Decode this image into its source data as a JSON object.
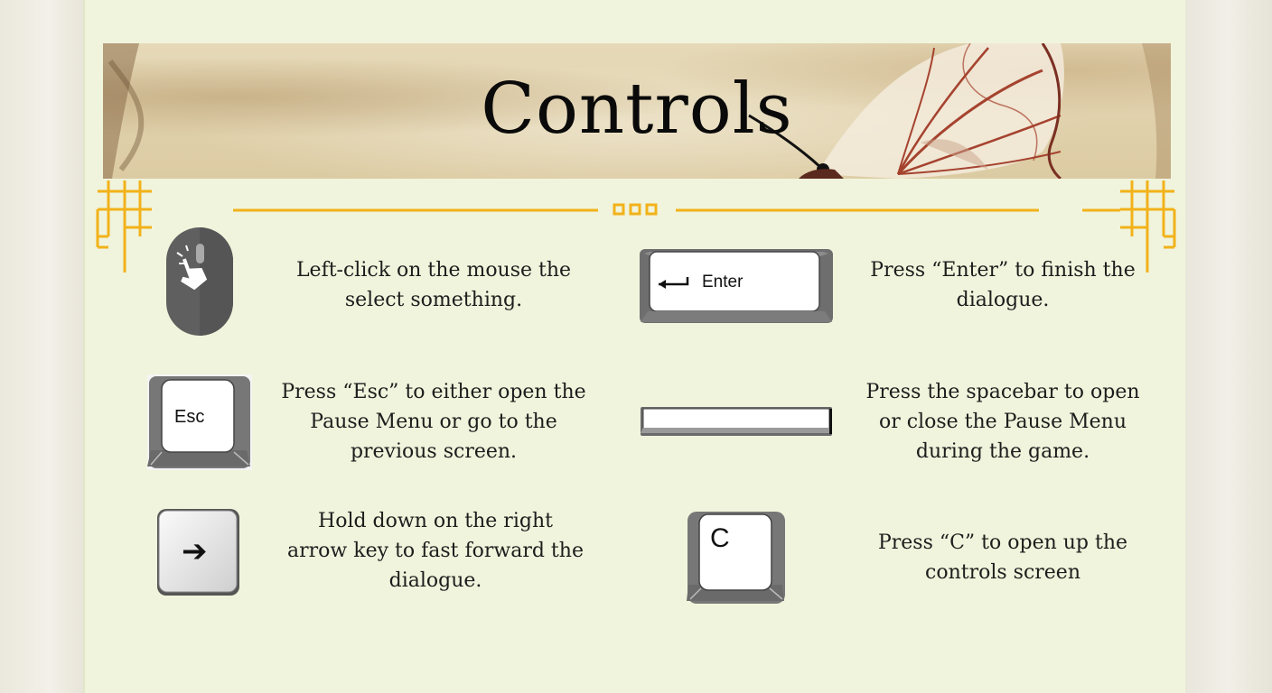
{
  "title": "Controls",
  "colors": {
    "panel": "#f0f4dc",
    "accent": "#f2b21a",
    "text": "#1d1d1d"
  },
  "controls": [
    {
      "id": "mouse",
      "icon": "mouse-click-icon",
      "lines": [
        "Left-click on the mouse the",
        "select something."
      ]
    },
    {
      "id": "enter",
      "icon": "enter-key-icon",
      "key_label": "Enter",
      "lines": [
        "Press “Enter” to finish the",
        "dialogue."
      ]
    },
    {
      "id": "esc",
      "icon": "esc-key-icon",
      "key_label": "Esc",
      "lines": [
        "Press “Esc” to either open the",
        "Pause Menu or go to the",
        "previous screen."
      ]
    },
    {
      "id": "space",
      "icon": "spacebar-key-icon",
      "lines": [
        "Press the spacebar to open",
        "or close the Pause Menu",
        "during the game."
      ]
    },
    {
      "id": "arrow",
      "icon": "right-arrow-key-icon",
      "key_label": "➔",
      "lines": [
        "Hold down on the right",
        "arrow key to fast forward the",
        "dialogue."
      ]
    },
    {
      "id": "c",
      "icon": "c-key-icon",
      "key_label": "C",
      "lines": [
        "Press “C” to open up the",
        "controls screen"
      ]
    }
  ]
}
